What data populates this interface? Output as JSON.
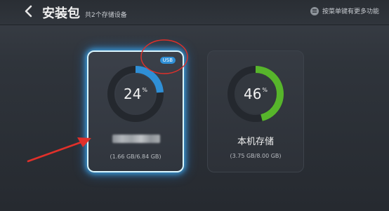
{
  "header": {
    "back_icon": "chevron-left-icon",
    "title": "安装包",
    "subtitle": "共2个存储设备",
    "menu_icon": "menu-icon",
    "menu_hint": "按菜单键有更多功能"
  },
  "devices": [
    {
      "id": "usb",
      "badge": "USB",
      "percent": "24",
      "percent_value": 24,
      "percent_unit": "%",
      "name": "",
      "name_obscured": true,
      "size": "(1.66 GB/6.84 GB)",
      "ring_color": "#2f8fd6"
    },
    {
      "id": "local",
      "percent": "46",
      "percent_value": 46,
      "percent_unit": "%",
      "name": "本机存储",
      "size": "(3.75 GB/8.00 GB)",
      "ring_color": "#57b52b"
    }
  ],
  "annotations": {
    "color": "#e0302a"
  },
  "colors": {
    "selected_glow": "#3facf0",
    "ring_track": "#24282e"
  }
}
